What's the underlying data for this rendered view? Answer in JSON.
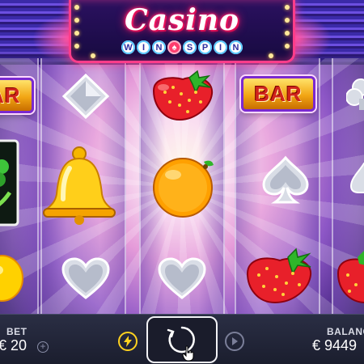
{
  "game": {
    "logo_title": "Casino",
    "logo_subtitle_letters": [
      "W",
      "I",
      "N",
      "♠",
      "S",
      "P",
      "I",
      "N"
    ]
  },
  "reels": [
    [
      "bar",
      "shamrock",
      "lemon"
    ],
    [
      "diamond",
      "bell",
      "heart"
    ],
    [
      "strawberry",
      "orange",
      "heart"
    ],
    [
      "bar",
      "spade",
      "strawberry"
    ],
    [
      "club",
      "spade",
      "strawberry"
    ]
  ],
  "symbols": {
    "bar_text": "BAR"
  },
  "controls": {
    "bet_label": "BET",
    "bet_value": "€ 20",
    "balance_label": "BALANC",
    "balance_value": "€ 9449",
    "plus_symbol": "+"
  },
  "colors": {
    "neon_pink": "#ff3d8a",
    "bar_text": "#d0241b",
    "turbo_yellow": "#ffd21f",
    "panel": "#1b1e2e"
  },
  "icons": {
    "turbo": "lightning-icon",
    "spin": "spin-arrow-icon",
    "autoplay": "play-icon",
    "cursor": "hand-cursor-icon"
  }
}
